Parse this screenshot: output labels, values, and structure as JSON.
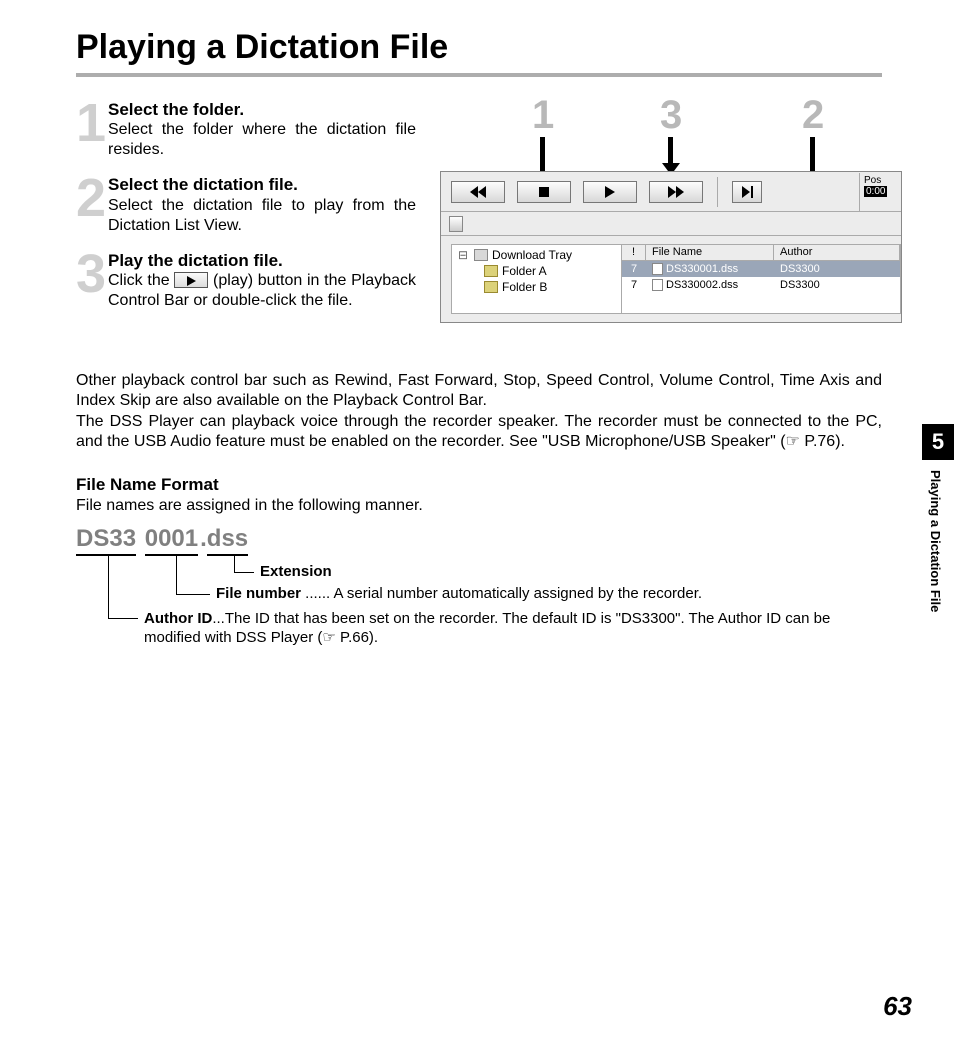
{
  "title": "Playing a Dictation File",
  "steps": [
    {
      "num": "1",
      "head": "Select the folder.",
      "text": "Select the folder where the dictation file resides."
    },
    {
      "num": "2",
      "head": "Select the dictation file.",
      "text": "Select the dictation file to play from the Dictation List View."
    },
    {
      "num": "3",
      "head": "Play the dictation file.",
      "text_before": "Click the ",
      "text_after": " (play) button in the Playback Control Bar or double-click the file."
    }
  ],
  "callouts": {
    "a": "1",
    "b": "3",
    "c": "2"
  },
  "app": {
    "pos_label": "Pos",
    "pos_time": "0:00",
    "tree": {
      "root": "Download Tray",
      "a": "Folder A",
      "b": "Folder B"
    },
    "list": {
      "headers": {
        "c1": "!",
        "c2": "File Name",
        "c3": "Author"
      },
      "rows": [
        {
          "idx": "7",
          "name": "DS330001.dss",
          "author": "DS3300",
          "sel": true
        },
        {
          "idx": "7",
          "name": "DS330002.dss",
          "author": "DS3300",
          "sel": false
        }
      ]
    }
  },
  "para1": "Other playback control bar such as Rewind, Fast Forward, Stop, Speed Control, Volume Control, Time Axis and Index Skip are also available on the Playback Control Bar.",
  "para2": "The DSS Player can playback voice through the recorder speaker. The recorder must be connected to the PC, and the USB Audio feature must be enabled on the recorder. See \"USB Microphone/USB Speaker\" (☞ P.76).",
  "fmt_head": "File Name Format",
  "fmt_line": "File names are assigned in the following manner.",
  "fn": {
    "author": "DS33",
    "num": "0001",
    "ext": "dss",
    "dot1": " ",
    "dot2": "."
  },
  "fn_labels": {
    "ext": "Extension",
    "num_b": "File number",
    "num_t": " ...... A serial number automatically assigned by the recorder.",
    "auth_b": "Author ID",
    "auth_t": "...The ID that has been set on the recorder. The default ID is \"DS3300\". The Author ID can be modified with DSS Player (☞ P.66)."
  },
  "side": {
    "chapter": "5",
    "title": "Playing a Dictation File"
  },
  "page_number": "63"
}
